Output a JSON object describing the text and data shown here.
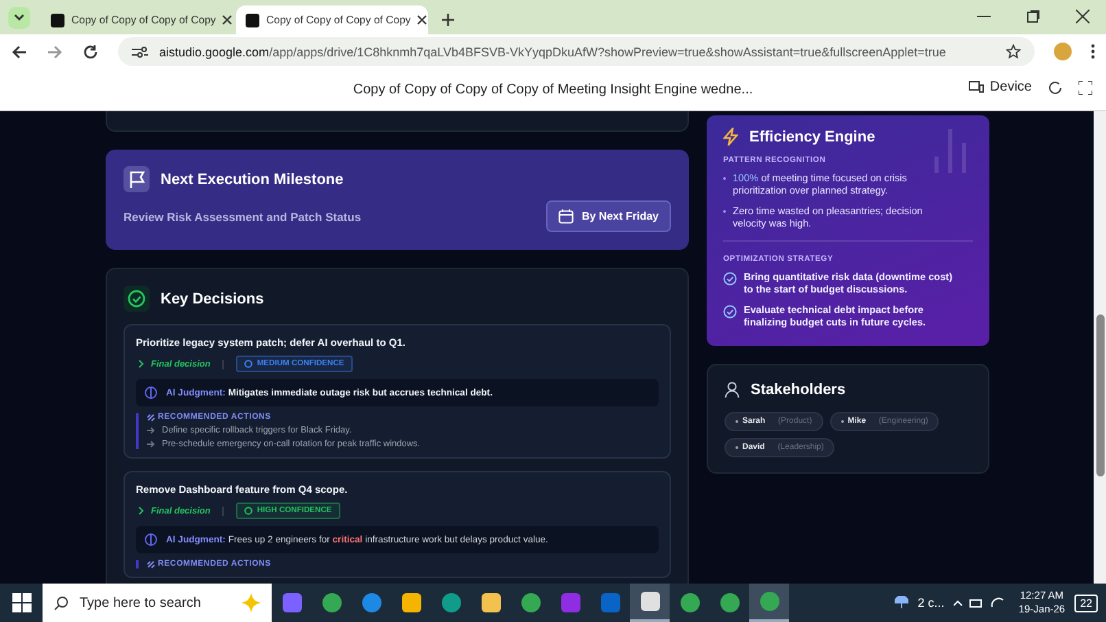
{
  "browser": {
    "tabs": [
      {
        "title": "Copy of Copy of Copy of Copy",
        "selected": false
      },
      {
        "title": "Copy of Copy of Copy of Copy",
        "selected": true
      }
    ],
    "url_host": "aistudio.google.com",
    "url_rest": "/app/apps/drive/1C8hknmh7qaLVb4BFSVB-VkYyqpDkuAfW?showPreview=true&showAssistant=true&fullscreenApplet=true"
  },
  "app_header": {
    "title": "Copy of Copy of Copy of Copy of Meeting Insight Engine wedne...",
    "device_label": "Device"
  },
  "milestone": {
    "title": "Next Execution Milestone",
    "task": "Review Risk Assessment and Patch Status",
    "due": "By Next Friday"
  },
  "decisions": {
    "title": "Key Decisions",
    "items": [
      {
        "title": "Prioritize legacy system patch; defer AI overhaul to Q1.",
        "status": "Final decision",
        "confidence": "MEDIUM CONFIDENCE",
        "color": "#3b82f6",
        "judgment_label": "AI Judgment:",
        "judgment": [
          {
            "text": "Mitigates immediate outage risk but accrues technical debt.",
            "kind": "bold"
          }
        ],
        "actions_label": "RECOMMENDED ACTIONS",
        "actions": [
          "Define specific rollback triggers for Black Friday.",
          "Pre-schedule emergency on-call rotation for peak traffic windows."
        ]
      },
      {
        "title": "Remove Dashboard feature from Q4 scope.",
        "status": "Final decision",
        "confidence": "HIGH CONFIDENCE",
        "color": "#22c55e",
        "judgment_label": "AI Judgment:",
        "judgment": [
          {
            "text": "Frees up 2 engineers for ",
            "kind": "plain"
          },
          {
            "text": "critical",
            "kind": "alert"
          },
          {
            "text": " infrastructure work but delays product value.",
            "kind": "plain"
          }
        ],
        "actions_label": "RECOMMENDED ACTIONS"
      }
    ]
  },
  "efficiency": {
    "title": "Efficiency Engine",
    "pattern_label": "PATTERN RECOGNITION",
    "patterns": [
      [
        {
          "text": "100%",
          "kind": "highlight"
        },
        {
          "text": " of meeting time focused on crisis prioritization over planned strategy.",
          "kind": "plain"
        }
      ],
      [
        {
          "text": "Zero time wasted on pleasantries; decision velocity was high.",
          "kind": "plain"
        }
      ]
    ],
    "strategy_label": "OPTIMIZATION STRATEGY",
    "strategies": [
      "Bring quantitative risk data (downtime cost) to the start of budget discussions.",
      "Evaluate technical debt impact before finalizing budget cuts in future cycles."
    ]
  },
  "stakeholders": {
    "title": "Stakeholders",
    "people": [
      {
        "name": "Sarah",
        "role": "(Product)"
      },
      {
        "name": "Mike",
        "role": "(Engineering)"
      },
      {
        "name": "David",
        "role": "(Leadership)"
      }
    ]
  },
  "taskbar": {
    "search_placeholder": "Type here to search",
    "apps": [
      {
        "kind": "copilot",
        "active": false
      },
      {
        "kind": "chrome",
        "active": false
      },
      {
        "kind": "ie",
        "active": false
      },
      {
        "kind": "store",
        "active": false
      },
      {
        "kind": "edge",
        "active": false
      },
      {
        "kind": "folder",
        "active": false
      },
      {
        "kind": "chrome",
        "active": false
      },
      {
        "kind": "pdf",
        "active": false
      },
      {
        "kind": "outlook",
        "active": false
      },
      {
        "kind": "java",
        "active": true
      },
      {
        "kind": "chrome",
        "active": false
      },
      {
        "kind": "chrome",
        "active": false
      },
      {
        "kind": "chrome",
        "active": true
      }
    ],
    "weather": "2 c...",
    "time": "12:27 AM",
    "date": "19-Jan-26",
    "notifications": "22"
  }
}
